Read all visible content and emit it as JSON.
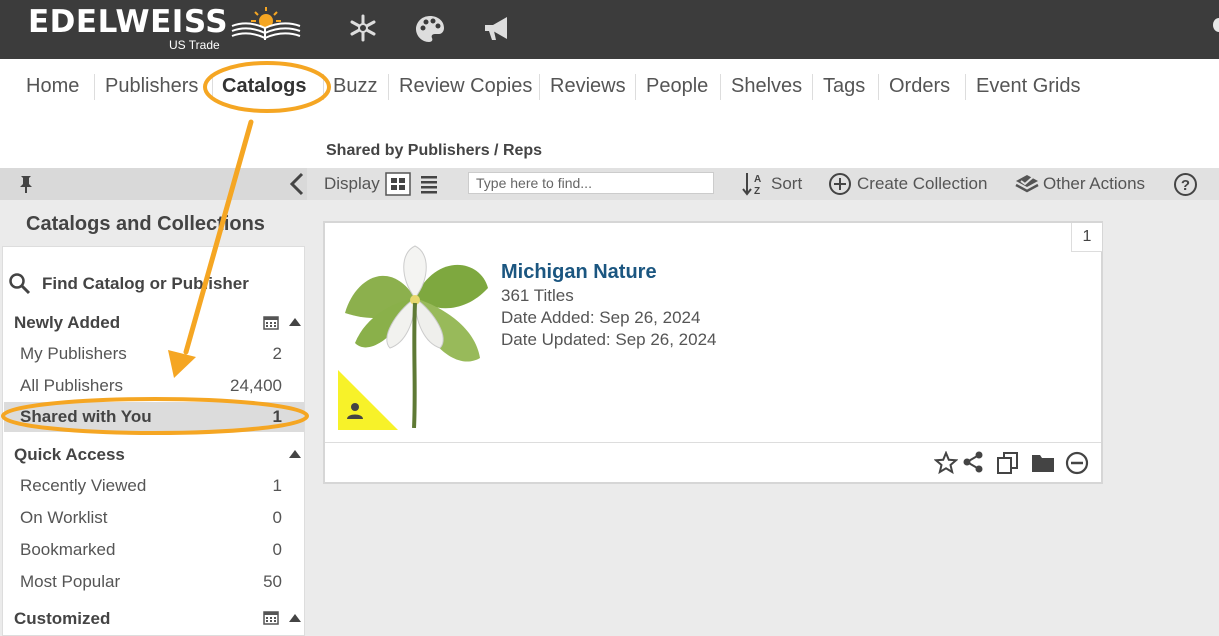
{
  "app": {
    "brand": "EDELWEISS",
    "subbrand": "US Trade"
  },
  "topbar": {
    "icons": [
      "snowflake-icon",
      "palette-icon",
      "megaphone-icon"
    ]
  },
  "nav": {
    "items": [
      "Home",
      "Publishers",
      "Catalogs",
      "Buzz",
      "Review Copies",
      "Reviews",
      "People",
      "Shelves",
      "Tags",
      "Orders",
      "Event Grids"
    ],
    "active": "Catalogs"
  },
  "page": {
    "heading": "Shared by Publishers / Reps"
  },
  "toolbar": {
    "display_label": "Display",
    "search_placeholder": "Type here to find...",
    "sort_label": "Sort",
    "create_collection_label": "Create Collection",
    "other_actions_label": "Other Actions"
  },
  "sidebar": {
    "title": "Catalogs and Collections",
    "find_label": "Find Catalog or Publisher",
    "newly_added": {
      "heading": "Newly Added",
      "rows": [
        {
          "label": "My Publishers",
          "count": "2"
        },
        {
          "label": "All Publishers",
          "count": "24,400"
        },
        {
          "label": "Shared with You",
          "count": "1"
        }
      ],
      "selected": "Shared with You"
    },
    "quick_access": {
      "heading": "Quick Access",
      "rows": [
        {
          "label": "Recently Viewed",
          "count": "1"
        },
        {
          "label": "On Worklist",
          "count": "0"
        },
        {
          "label": "Bookmarked",
          "count": "0"
        },
        {
          "label": "Most Popular",
          "count": "50"
        }
      ]
    },
    "customized": {
      "heading": "Customized"
    }
  },
  "catalog_card": {
    "count": "1",
    "title": "Michigan Nature",
    "titles": "361 Titles",
    "date_added": "Date Added: Sep 26, 2024",
    "date_updated": "Date Updated: Sep 26, 2024",
    "actions": [
      "star-icon",
      "share-icon",
      "copy-icon",
      "folder-icon",
      "remove-icon"
    ]
  },
  "colors": {
    "topbar": "#3c3c3c",
    "annotation_orange": "#f5a623",
    "title_blue": "#1b5680",
    "badge_yellow": "#f7f229"
  }
}
